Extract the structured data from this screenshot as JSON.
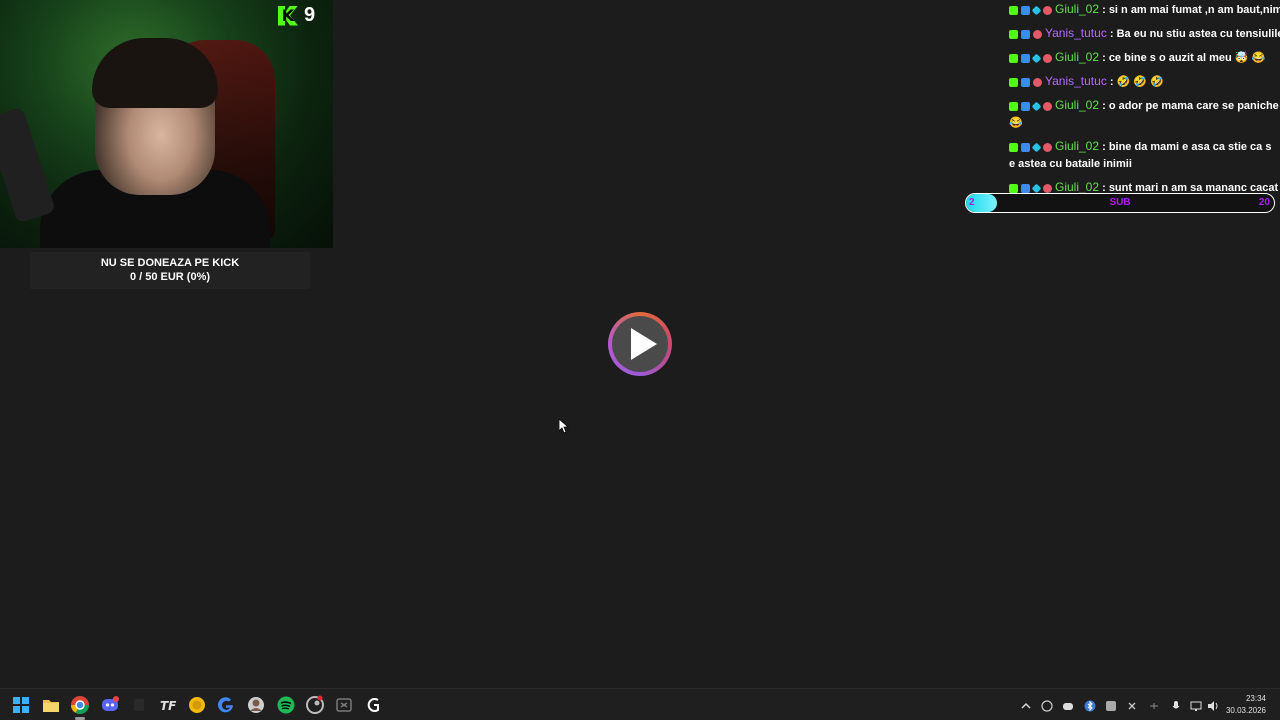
{
  "webcam": {
    "viewer_count": "9"
  },
  "donation": {
    "title": "NU SE DONEAZA PE KICK",
    "progress": "0 / 50 EUR (0%)",
    "progress_fraction": 0
  },
  "chat": {
    "messages": [
      {
        "user": "Giuli_02",
        "color": "green",
        "text": ": si n am mai fumat ,n am baut,nimic"
      },
      {
        "user": "Yanis_tutuc",
        "color": "purple",
        "text": ": Ba eu nu stiu astea cu tensiulile"
      },
      {
        "user": "Giuli_02",
        "color": "green",
        "text": ": ce bine s o auzit al meu 🤯 😂"
      },
      {
        "user": "Yanis_tutuc",
        "color": "purple",
        "text": ": 🤣 🤣 🤣"
      },
      {
        "user": "Giuli_02",
        "color": "green",
        "text": ": o ador pe mama care se paniche 😂"
      },
      {
        "user": "Giuli_02",
        "color": "green",
        "text": ": bine da mami e asa ca stie ca s e astea cu bataile inimii"
      },
      {
        "user": "Giuli_02",
        "color": "green",
        "text": ": sunt mari n am sa mananc cacat"
      }
    ]
  },
  "sub_goal": {
    "current": "2",
    "target": "20",
    "label": "SUB",
    "progress_fraction": 0.1
  },
  "taskbar": {
    "time": "23:34",
    "date": "30.03.2026",
    "pinned": [
      "windows-start-icon",
      "file-explorer-icon",
      "chrome-icon",
      "discord-icon",
      "blank-app-icon",
      "tf-app-icon",
      "coin-app-icon",
      "google-icon",
      "avatar-app-icon",
      "spotify-icon",
      "steam-icon",
      "app-icon",
      "g-app-icon"
    ]
  },
  "colors": {
    "kick_green": "#53fc18",
    "user_green": "#63e04b",
    "user_purple": "#b46bff",
    "sub_label": "#b018ff",
    "sub_fill": "#1dd8e8"
  }
}
